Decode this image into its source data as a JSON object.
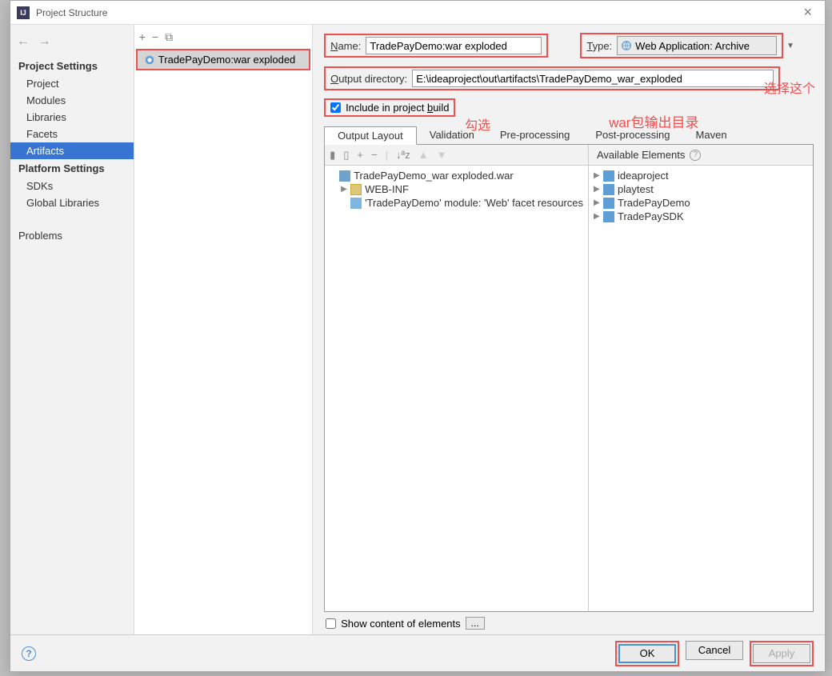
{
  "window": {
    "title": "Project Structure"
  },
  "sidebar": {
    "section1": "Project Settings",
    "items1": [
      "Project",
      "Modules",
      "Libraries",
      "Facets",
      "Artifacts"
    ],
    "section2": "Platform Settings",
    "items2": [
      "SDKs",
      "Global Libraries"
    ],
    "problems": "Problems"
  },
  "artifact_list": {
    "selected": "TradePayDemo:war exploded"
  },
  "form": {
    "name_label": "Name:",
    "name_value": "TradePayDemo:war exploded",
    "type_label": "Type:",
    "type_value": "Web Application: Archive",
    "output_label": "Output directory:",
    "output_value": "E:\\ideaproject\\out\\artifacts\\TradePayDemo_war_exploded",
    "include_label": "Include in project build",
    "include_checked": true
  },
  "annotations": {
    "select_this": "选择这个",
    "check": "勾选",
    "war_output": "war包输出目录"
  },
  "tabs": [
    "Output Layout",
    "Validation",
    "Pre-processing",
    "Post-processing",
    "Maven"
  ],
  "output_tree": [
    {
      "level": 0,
      "icon": "war",
      "label": "TradePayDemo_war exploded.war",
      "expander": ""
    },
    {
      "level": 1,
      "icon": "folder",
      "label": "WEB-INF",
      "expander": "▶"
    },
    {
      "level": 1,
      "icon": "facet",
      "label": "'TradePayDemo' module: 'Web' facet resources",
      "expander": ""
    }
  ],
  "available": {
    "header": "Available Elements",
    "items": [
      {
        "icon": "mod",
        "label": "ideaproject"
      },
      {
        "icon": "mod",
        "label": "playtest"
      },
      {
        "icon": "mod",
        "label": "TradePayDemo"
      },
      {
        "icon": "mod",
        "label": "TradePaySDK"
      }
    ]
  },
  "bottom": {
    "show_content_label": "Show content of elements",
    "more": "..."
  },
  "footer": {
    "ok": "OK",
    "cancel": "Cancel",
    "apply": "Apply"
  }
}
